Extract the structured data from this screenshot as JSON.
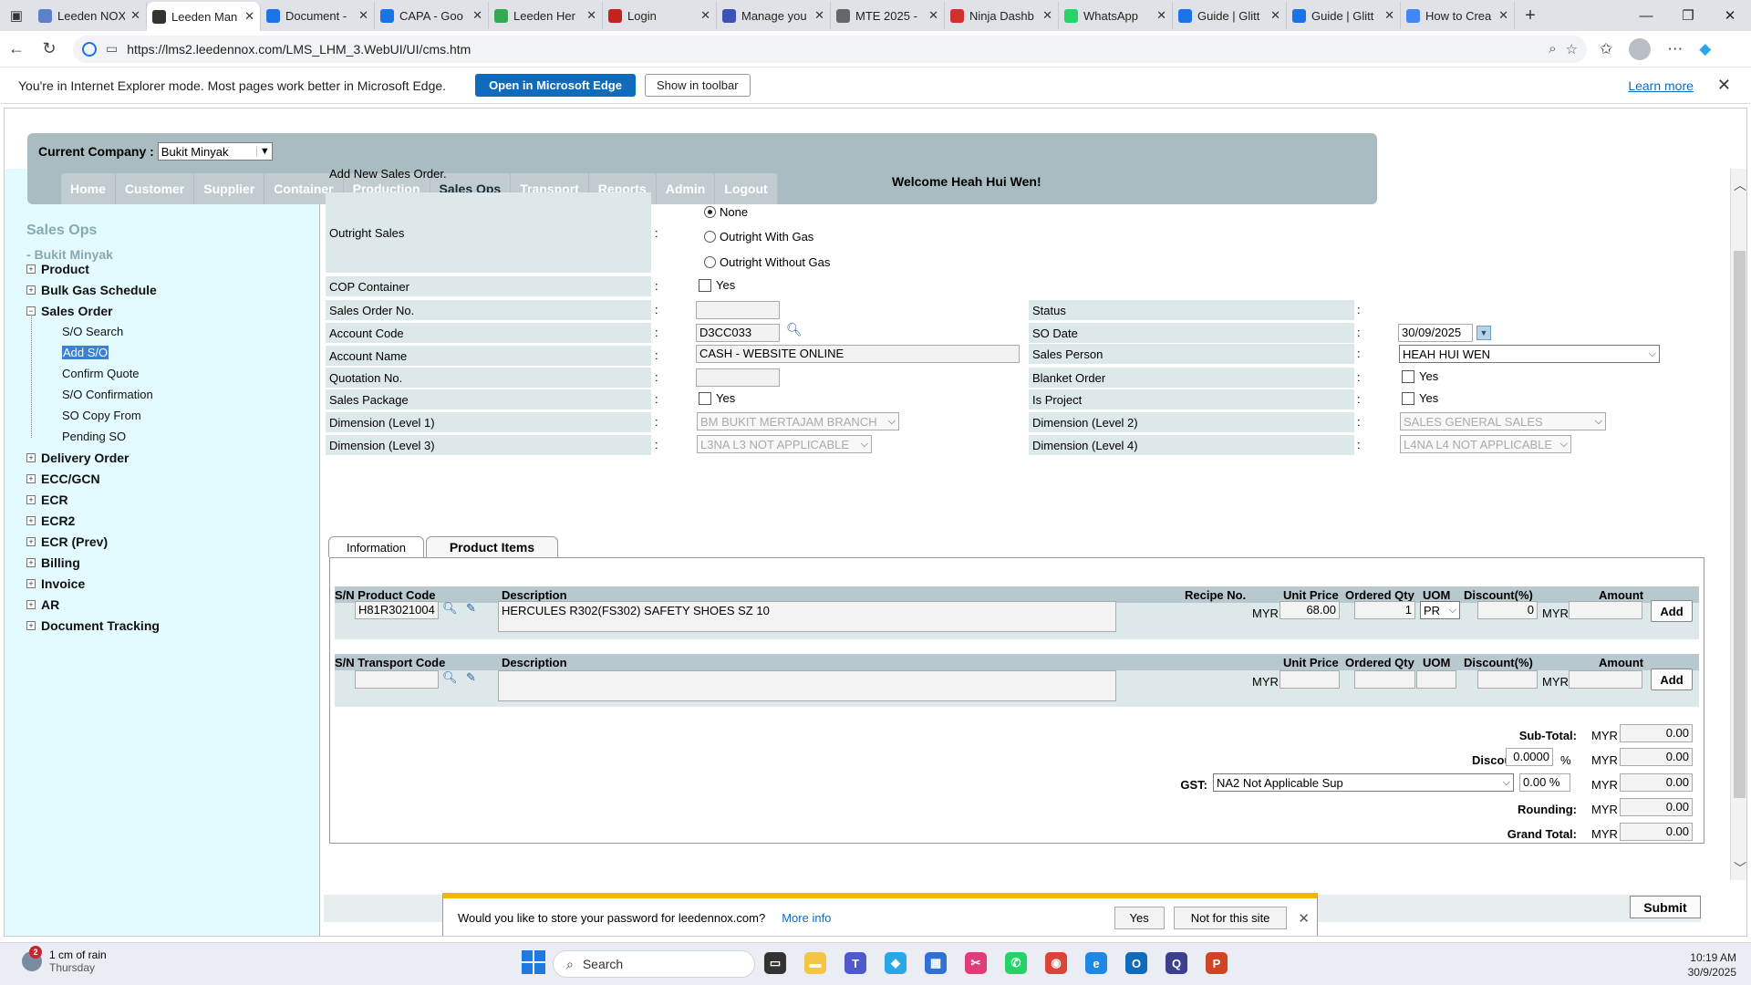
{
  "browser": {
    "tabs": [
      {
        "label": "Leeden NOX",
        "icon": "edge-doc-icon",
        "color": "#5b7fc9",
        "active": false
      },
      {
        "label": "Leeden Man",
        "icon": "ie-icon",
        "color": "#333333",
        "active": true
      },
      {
        "label": "Document -",
        "icon": "sharepoint-icon",
        "color": "#1a73e8",
        "active": false
      },
      {
        "label": "CAPA - Goo",
        "icon": "sharepoint-icon",
        "color": "#1a73e8",
        "active": false
      },
      {
        "label": "Leeden Her",
        "icon": "maps-icon",
        "color": "#34a853",
        "active": false
      },
      {
        "label": "Login",
        "icon": "gmail-icon",
        "color": "#c5221f",
        "active": false
      },
      {
        "label": "Manage you",
        "icon": "chevron-icon",
        "color": "#3f51b5",
        "active": false
      },
      {
        "label": "MTE 2025 -",
        "icon": "globe-icon",
        "color": "#666666",
        "active": false
      },
      {
        "label": "Ninja Dashb",
        "icon": "ninja-icon",
        "color": "#d32f2f",
        "active": false
      },
      {
        "label": "WhatsApp",
        "icon": "whatsapp-icon",
        "color": "#25d366",
        "active": false
      },
      {
        "label": "Guide | Glitt",
        "icon": "sharepoint-icon",
        "color": "#1a73e8",
        "active": false
      },
      {
        "label": "Guide | Glitt",
        "icon": "sharepoint-icon",
        "color": "#1a73e8",
        "active": false
      },
      {
        "label": "How to Crea",
        "icon": "google-icon",
        "color": "#4285f4",
        "active": false
      }
    ],
    "url": "https://lms2.leedennox.com/LMS_LHM_3.WebUI/UI/cms.htm",
    "ie_message": "You're in Internet Explorer mode. Most pages work better in Microsoft Edge.",
    "open_edge_label": "Open in Microsoft Edge",
    "show_toolbar_label": "Show in toolbar",
    "learn_more_label": "Learn more"
  },
  "header": {
    "company_label": "Current Company :",
    "company_value": "Bukit Minyak",
    "menu": [
      "Home",
      "Customer",
      "Supplier",
      "Container",
      "Production",
      "Sales Ops",
      "Transport",
      "Reports",
      "Admin",
      "Logout"
    ],
    "active_menu": "Sales Ops",
    "welcome": "Welcome Heah Hui Wen!"
  },
  "sidebar": {
    "title": "Sales Ops",
    "company": "- Bukit Minyak",
    "groups_top": [
      "Product",
      "Bulk Gas Schedule"
    ],
    "sales_order_label": "Sales Order",
    "sales_order_items": [
      "S/O Search",
      "Add S/O",
      "Confirm Quote",
      "S/O Confirmation",
      "SO Copy From",
      "Pending SO"
    ],
    "selected_item": "Add S/O",
    "groups_bottom": [
      "Delivery Order",
      "ECC/GCN",
      "ECR",
      "ECR2",
      "ECR (Prev)",
      "Billing",
      "Invoice",
      "AR",
      "Document Tracking"
    ]
  },
  "form": {
    "title": "Add New Sales Order.",
    "outright_label": "Outright Sales",
    "outright_options": [
      "None",
      "Outright With Gas",
      "Outright Without Gas"
    ],
    "outright_selected": "None",
    "cop_label": "COP Container",
    "yes_label": "Yes",
    "so_no_label": "Sales Order No.",
    "so_no_value": "",
    "account_code_label": "Account Code",
    "account_code_value": "D3CC033",
    "account_name_label": "Account Name",
    "account_name_value": "CASH - WEBSITE ONLINE",
    "quotation_label": "Quotation No.",
    "quotation_value": "",
    "sales_package_label": "Sales Package",
    "dim1_label": "Dimension (Level 1)",
    "dim1_value": "BM BUKIT MERTAJAM BRANCH",
    "dim3_label": "Dimension (Level 3)",
    "dim3_value": "L3NA L3 NOT APPLICABLE",
    "status_label": "Status",
    "status_value": "",
    "so_date_label": "SO Date",
    "so_date_value": "30/09/2025",
    "sales_person_label": "Sales Person",
    "sales_person_value": "HEAH HUI WEN",
    "blanket_label": "Blanket Order",
    "is_project_label": "Is Project",
    "dim2_label": "Dimension (Level 2)",
    "dim2_value": "SALES GENERAL SALES",
    "dim4_label": "Dimension (Level 4)",
    "dim4_value": "L4NA L4 NOT APPLICABLE",
    "colon": ":"
  },
  "tabs": {
    "information": "Information",
    "product_items": "Product Items",
    "active": "Product Items"
  },
  "product_table": {
    "headers": [
      "S/N Product Code",
      "Description",
      "Recipe No.",
      "Unit Price",
      "Ordered Qty",
      "UOM",
      "Discount(%)",
      "Amount"
    ],
    "row": {
      "product_code": "H81R3021004",
      "description": "HERCULES R302(FS302) SAFETY SHOES SZ 10",
      "currency": "MYR",
      "unit_price": "68.00",
      "ordered_qty": "1",
      "uom": "PR",
      "discount": "0",
      "amount": ""
    },
    "add_label": "Add"
  },
  "transport_table": {
    "headers": [
      "S/N Transport Code",
      "Description",
      "Unit Price",
      "Ordered Qty",
      "UOM",
      "Discount(%)",
      "Amount"
    ],
    "row": {
      "transport_code": "",
      "description": "",
      "currency": "MYR",
      "unit_price": "",
      "ordered_qty": "",
      "uom": "",
      "discount": "",
      "amount": ""
    },
    "add_label": "Add"
  },
  "totals": {
    "currency": "MYR",
    "subtotal_label": "Sub-Total:",
    "subtotal": "0.00",
    "discount_label": "Discount:",
    "discount_pct": "0.0000",
    "pct_sign": "%",
    "discount": "0.00",
    "gst_label": "GST:",
    "gst_code": "NA2 Not Applicable Sup",
    "gst_pct": "0.00 %",
    "gst": "0.00",
    "rounding_label": "Rounding:",
    "rounding": "0.00",
    "grand_total_label": "Grand Total:",
    "grand_total": "0.00"
  },
  "submit_label": "Submit",
  "password_prompt": {
    "message": "Would you like to store your password for leedennox.com?",
    "more_info": "More info",
    "yes": "Yes",
    "no": "Not for this site"
  },
  "taskbar": {
    "weather": "1 cm of rain",
    "weather_day": "Thursday",
    "weather_badge": "2",
    "search_placeholder": "Search",
    "time": "10:19 AM",
    "date": "30/9/2025",
    "apps": [
      {
        "name": "task-view-icon",
        "color": "#333333"
      },
      {
        "name": "file-explorer-icon",
        "color": "#f4c542"
      },
      {
        "name": "teams-icon",
        "color": "#5059c9"
      },
      {
        "name": "copilot-icon",
        "color": "#2aa7e8"
      },
      {
        "name": "store-icon",
        "color": "#2f6fd6"
      },
      {
        "name": "snipping-icon",
        "color": "#e03c7a"
      },
      {
        "name": "whatsapp-icon",
        "color": "#25d366"
      },
      {
        "name": "chrome-icon",
        "color": "#db4437"
      },
      {
        "name": "edge-icon",
        "color": "#1e88e5"
      },
      {
        "name": "outlook-icon",
        "color": "#0f6cbd"
      },
      {
        "name": "app-q-icon",
        "color": "#3b3f8f"
      },
      {
        "name": "powerpoint-icon",
        "color": "#d04423"
      }
    ]
  }
}
